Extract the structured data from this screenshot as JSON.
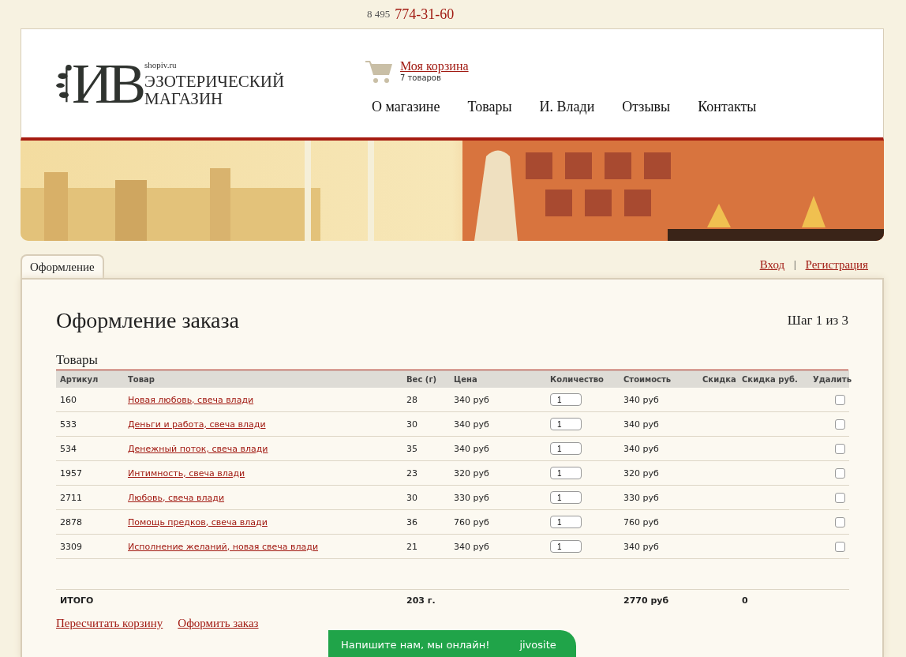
{
  "phone": {
    "prefix": "8 495",
    "number": "774-31-60"
  },
  "logo": {
    "monogram": "ИВ",
    "site": "shopiv.ru",
    "line1": "ЭЗОТЕРИЧЕСКИЙ",
    "line2": "МАГАЗИН"
  },
  "cart": {
    "link": "Моя корзина",
    "count": "7 товаров"
  },
  "nav": [
    "О магазине",
    "Товары",
    "И. Влади",
    "Отзывы",
    "Контакты"
  ],
  "tabs": [
    {
      "label": "Оформление",
      "selected": true
    }
  ],
  "auth": {
    "login": "Вход",
    "separator": "|",
    "register": "Регистрация"
  },
  "page": {
    "title": "Оформление заказа",
    "step": "Шаг 1 из 3",
    "section": "Товары"
  },
  "table": {
    "columns": [
      "Артикул",
      "Товар",
      "Вес (г)",
      "Цена",
      "Количество",
      "Стоимость",
      "Скидка",
      "Скидка руб.",
      "Удалить"
    ],
    "rows": [
      {
        "sku": "160",
        "name": "Новая любовь, свеча влади",
        "weight": "28",
        "price": "340 руб",
        "qty": "1",
        "cost": "340 руб",
        "remove": false
      },
      {
        "sku": "533",
        "name": "Деньги и работа, свеча влади",
        "weight": "30",
        "price": "340 руб",
        "qty": "1",
        "cost": "340 руб",
        "remove": false
      },
      {
        "sku": "534",
        "name": "Денежный поток, свеча влади",
        "weight": "35",
        "price": "340 руб",
        "qty": "1",
        "cost": "340 руб",
        "remove": false
      },
      {
        "sku": "1957",
        "name": "Интимность, свеча влади",
        "weight": "23",
        "price": "320 руб",
        "qty": "1",
        "cost": "320 руб",
        "remove": false
      },
      {
        "sku": "2711",
        "name": "Любовь, свеча влади",
        "weight": "30",
        "price": "330 руб",
        "qty": "1",
        "cost": "330 руб",
        "remove": false
      },
      {
        "sku": "2878",
        "name": "Помощь предков, свеча влади",
        "weight": "36",
        "price": "760 руб",
        "qty": "1",
        "cost": "760 руб",
        "remove": false
      },
      {
        "sku": "3309",
        "name": "Исполнение желаний, новая свеча влади",
        "weight": "21",
        "price": "340 руб",
        "qty": "1",
        "cost": "340 руб",
        "remove": false
      }
    ],
    "total": {
      "label": "ИТОГО",
      "weight": "203 г.",
      "cost": "2770 руб",
      "discount": "0"
    }
  },
  "actions": [
    "Пересчитать корзину",
    "Оформить заказ"
  ],
  "chat": {
    "text": "Напишите нам, мы онлайн!",
    "brand": "jivosite"
  }
}
